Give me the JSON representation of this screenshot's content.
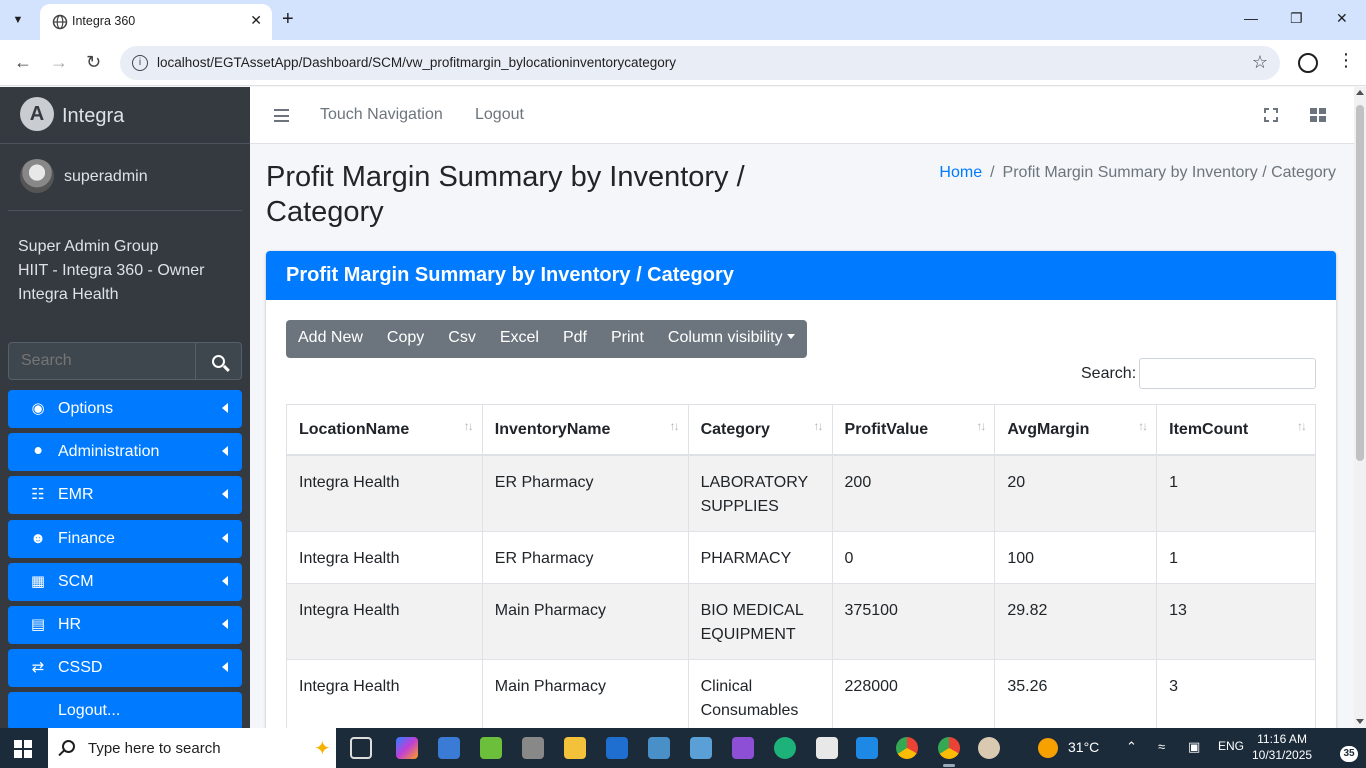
{
  "browser": {
    "tab_title": "Integra 360",
    "url": "localhost/EGTAssetApp/Dashboard/SCM/vw_profitmargin_bylocationinventorycategory"
  },
  "sidebar": {
    "brand": "Integra",
    "username": "superadmin",
    "org_lines": [
      "Super Admin Group",
      "HIIT - Integra 360 - Owner",
      "Integra Health"
    ],
    "search_placeholder": "Search",
    "items": [
      {
        "label": "Options",
        "icon": "dashboard-icon"
      },
      {
        "label": "Administration",
        "icon": "tags-icon"
      },
      {
        "label": "EMR",
        "icon": "sitemap-icon"
      },
      {
        "label": "Finance",
        "icon": "users-icon"
      },
      {
        "label": "SCM",
        "icon": "cubes-icon"
      },
      {
        "label": "HR",
        "icon": "file-icon"
      },
      {
        "label": "CSSD",
        "icon": "exchange-icon"
      },
      {
        "label": "Logout...",
        "icon": ""
      }
    ]
  },
  "topnav": {
    "touch_navigation": "Touch Navigation",
    "logout": "Logout"
  },
  "page": {
    "title": "Profit Margin Summary by Inventory / Category",
    "breadcrumb_home": "Home",
    "breadcrumb_current": "Profit Margin Summary by Inventory / Category"
  },
  "card": {
    "header": "Profit Margin Summary by Inventory / Category",
    "buttons": [
      "Add New",
      "Copy",
      "Csv",
      "Excel",
      "Pdf",
      "Print",
      "Column visibility"
    ],
    "search_label": "Search:"
  },
  "table": {
    "columns": [
      "LocationName",
      "InventoryName",
      "Category",
      "ProfitValue",
      "AvgMargin",
      "ItemCount"
    ],
    "rows": [
      [
        "Integra Health",
        "ER Pharmacy",
        "LABORATORY SUPPLIES",
        "200",
        "20",
        "1"
      ],
      [
        "Integra Health",
        "ER Pharmacy",
        "PHARMACY",
        "0",
        "100",
        "1"
      ],
      [
        "Integra Health",
        "Main Pharmacy",
        "BIO MEDICAL EQUIPMENT",
        "375100",
        "29.82",
        "13"
      ],
      [
        "Integra Health",
        "Main Pharmacy",
        "Clinical Consumables",
        "228000",
        "35.26",
        "3"
      ]
    ]
  },
  "taskbar": {
    "search_text": "Type here to search",
    "temperature": "31°C",
    "language": "ENG",
    "time": "11:16 AM",
    "date": "10/31/2025",
    "notification_count": "35"
  }
}
